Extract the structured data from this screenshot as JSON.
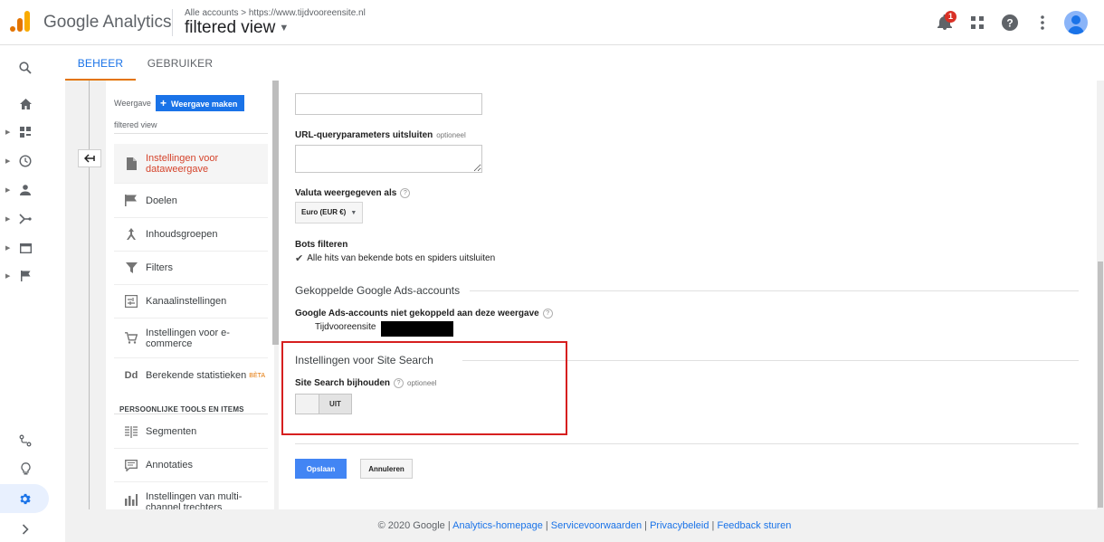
{
  "app": {
    "title": "Google Analytics",
    "breadcrumb": "Alle accounts > https://www.tijdvooreensite.nl",
    "view_name": "filtered view",
    "notification_count": "1"
  },
  "tabs": [
    {
      "label": "BEHEER",
      "active": true
    },
    {
      "label": "GEBRUIKER",
      "active": false
    }
  ],
  "view_column": {
    "header_label": "Weergave",
    "create_button": "Weergave maken",
    "current_view": "filtered view",
    "items": [
      {
        "label": "Instellingen voor dataweergave",
        "icon": "document-icon",
        "active": true
      },
      {
        "label": "Doelen",
        "icon": "flag-icon"
      },
      {
        "label": "Inhoudsgroepen",
        "icon": "content-grouping-icon"
      },
      {
        "label": "Filters",
        "icon": "filter-icon"
      },
      {
        "label": "Kanaalinstellingen",
        "icon": "channel-settings-icon"
      },
      {
        "label": "Instellingen voor e-commerce",
        "icon": "cart-icon"
      },
      {
        "label": "Berekende statistieken",
        "icon": "dd-icon",
        "badge": "BÈTA"
      }
    ],
    "section_title": "PERSOONLIJKE TOOLS EN ITEMS",
    "tools": [
      {
        "label": "Segmenten",
        "icon": "segments-icon"
      },
      {
        "label": "Annotaties",
        "icon": "annotation-icon"
      },
      {
        "label": "Instellingen van multi-channel trechters",
        "icon": "bar-chart-icon"
      }
    ]
  },
  "form": {
    "url_params_label": "URL-queryparameters uitsluiten",
    "optional": "optioneel",
    "currency_label": "Valuta weergegeven als",
    "currency_value": "Euro (EUR €)",
    "bots_label": "Bots filteren",
    "bots_checkbox": "Alle hits van bekende bots en spiders uitsluiten",
    "ads_section": "Gekoppelde Google Ads-accounts",
    "ads_unlinked_label": "Google Ads-accounts niet gekoppeld aan deze weergave",
    "ads_account_name": "Tijdvooreensite",
    "site_search_section": "Instellingen voor Site Search",
    "site_search_label": "Site Search bijhouden",
    "toggle_state": "UIT",
    "save": "Opslaan",
    "cancel": "Annuleren"
  },
  "footer": {
    "copyright": "© 2020 Google",
    "links": [
      "Analytics-homepage",
      "Servicevoorwaarden",
      "Privacybeleid",
      "Feedback sturen"
    ]
  },
  "colors": {
    "accent_blue": "#1a73e8",
    "ga_orange": "#e37400",
    "ga_yellow": "#f9ab00",
    "active_red": "#d5442c",
    "highlight_box": "#d61f1f"
  }
}
